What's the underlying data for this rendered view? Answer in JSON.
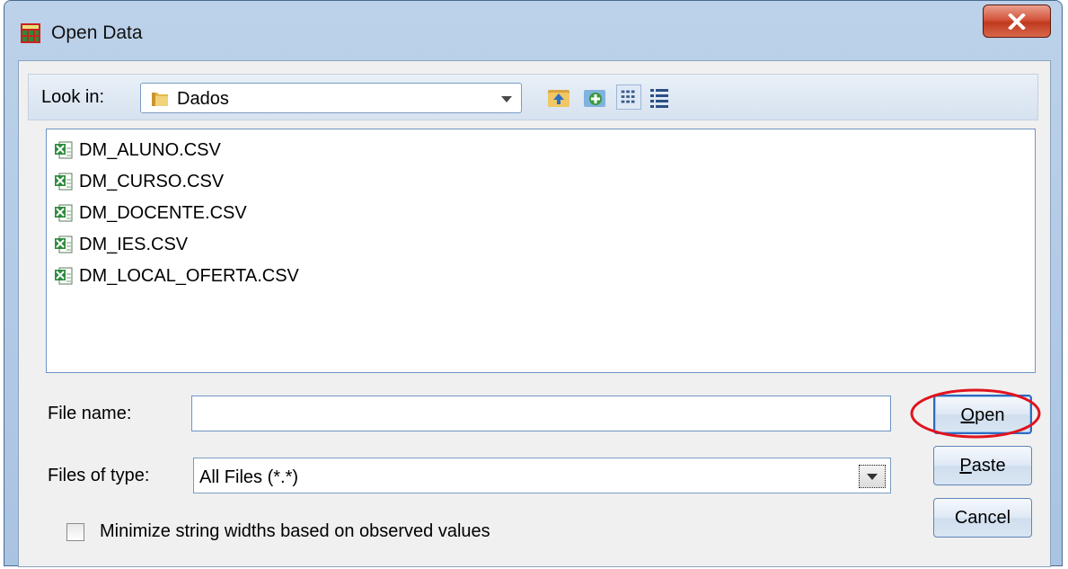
{
  "window": {
    "title": "Open Data",
    "close_icon": "close-icon"
  },
  "look_in": {
    "label": "Look in:",
    "value": "Dados",
    "folder_icon": "folder-icon"
  },
  "toolbar": {
    "icons": [
      "up-folder-icon",
      "new-folder-icon",
      "list-view-icon",
      "details-view-icon"
    ]
  },
  "files": [
    {
      "name": "DM_ALUNO.CSV",
      "icon": "csv-file-icon"
    },
    {
      "name": "DM_CURSO.CSV",
      "icon": "csv-file-icon"
    },
    {
      "name": "DM_DOCENTE.CSV",
      "icon": "csv-file-icon"
    },
    {
      "name": "DM_IES.CSV",
      "icon": "csv-file-icon"
    },
    {
      "name": "DM_LOCAL_OFERTA.CSV",
      "icon": "csv-file-icon"
    }
  ],
  "file_name": {
    "label": "File name:",
    "value": ""
  },
  "files_of_type": {
    "label": "Files of type:",
    "value": "All Files (*.*)"
  },
  "buttons": {
    "open": {
      "mnemonic": "O",
      "rest": "pen"
    },
    "paste": {
      "mnemonic": "P",
      "rest": "aste"
    },
    "cancel": "Cancel"
  },
  "minimize_option": {
    "label": "Minimize string widths based on observed values",
    "checked": false
  },
  "colors": {
    "highlight_ellipse": "#e0141e",
    "list_border": "#6f94c5",
    "frame": "#a9c3e2"
  }
}
